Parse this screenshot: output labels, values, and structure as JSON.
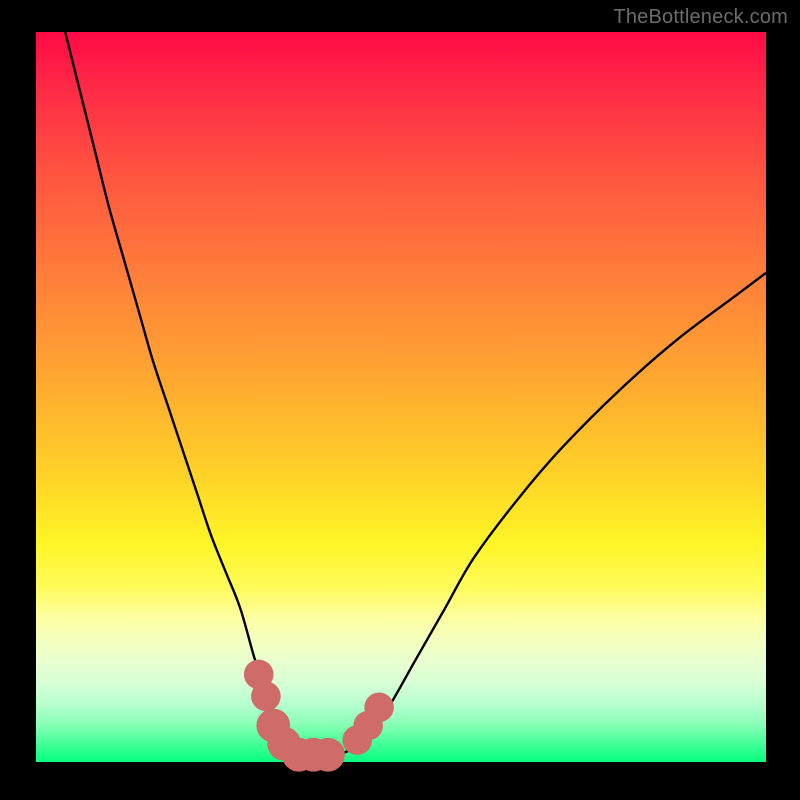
{
  "watermark": "TheBottleneck.com",
  "colors": {
    "frame": "#000000",
    "gradient_top": "#ff0a45",
    "gradient_bottom": "#06ff81",
    "curve": "#000000",
    "markers": "#cf6b68"
  },
  "chart_data": {
    "type": "line",
    "title": "",
    "xlabel": "",
    "ylabel": "",
    "xlim": [
      0,
      100
    ],
    "ylim": [
      0,
      100
    ],
    "series": [
      {
        "name": "bottleneck-curve",
        "x": [
          4,
          6,
          8,
          10,
          12,
          14,
          16,
          18,
          20,
          22,
          24,
          26,
          28,
          30,
          31.5,
          33,
          35,
          37,
          38,
          39.5,
          42,
          45,
          48,
          52,
          56,
          60,
          66,
          72,
          80,
          88,
          96,
          100
        ],
        "y": [
          100,
          92,
          84,
          76,
          69,
          62,
          55,
          49,
          43,
          37,
          31,
          26,
          21,
          14,
          10,
          6,
          3,
          1.5,
          1,
          1,
          1.2,
          3,
          7,
          14,
          21,
          28,
          36,
          43,
          51,
          58,
          64,
          67
        ]
      }
    ],
    "markers": [
      {
        "x": 30.5,
        "y": 12,
        "r": 1.2
      },
      {
        "x": 31.5,
        "y": 9,
        "r": 1.2
      },
      {
        "x": 32.5,
        "y": 5,
        "r": 1.5
      },
      {
        "x": 34,
        "y": 2.5,
        "r": 1.5
      },
      {
        "x": 36,
        "y": 1,
        "r": 1.5
      },
      {
        "x": 38,
        "y": 1,
        "r": 1.5
      },
      {
        "x": 40,
        "y": 1,
        "r": 1.5
      },
      {
        "x": 44,
        "y": 3,
        "r": 1.2
      },
      {
        "x": 45.5,
        "y": 5,
        "r": 1.2
      },
      {
        "x": 47,
        "y": 7.5,
        "r": 1.2
      }
    ]
  }
}
